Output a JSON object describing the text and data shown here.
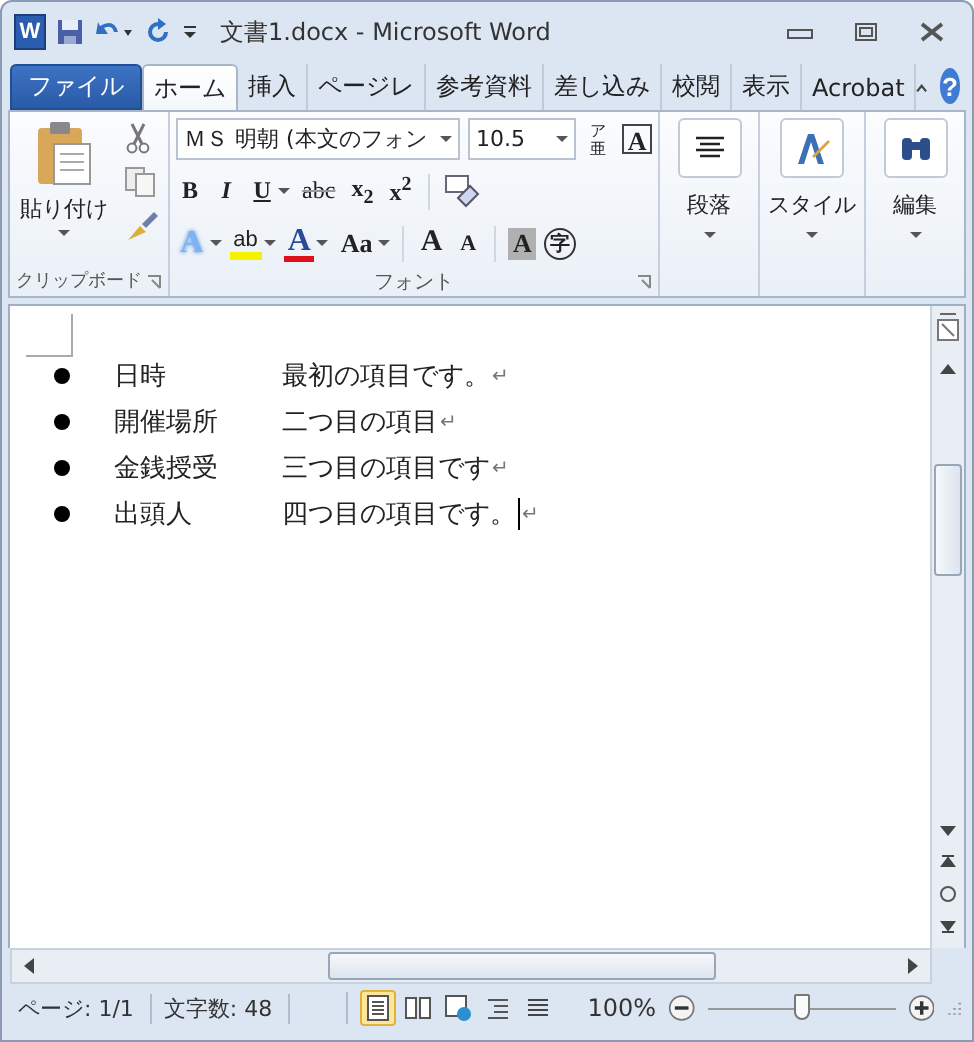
{
  "window": {
    "app_icon": "W",
    "title": "文書1.docx - Microsoft Word",
    "help": "?"
  },
  "tabs": [
    {
      "label": "ファイル",
      "kind": "file",
      "selected": false
    },
    {
      "label": "ホーム",
      "kind": "tab",
      "selected": true
    },
    {
      "label": "挿入",
      "kind": "tab",
      "selected": false
    },
    {
      "label": "ページレ",
      "kind": "tab",
      "selected": false
    },
    {
      "label": "参考資料",
      "kind": "tab",
      "selected": false
    },
    {
      "label": "差し込み",
      "kind": "tab",
      "selected": false
    },
    {
      "label": "校閲",
      "kind": "tab",
      "selected": false
    },
    {
      "label": "表示",
      "kind": "tab",
      "selected": false
    },
    {
      "label": "Acrobat",
      "kind": "tab",
      "selected": false
    }
  ],
  "ribbon": {
    "clipboard": {
      "paste": "貼り付け",
      "label": "クリップボード"
    },
    "font": {
      "font_name": "ＭＳ 明朝 (本文のフォン",
      "font_size": "10.5",
      "phonetic_top": "ア",
      "phonetic_bottom": "亜",
      "border_char": "A",
      "row2": [
        {
          "text": "B",
          "kind": "bold"
        },
        {
          "text": "I",
          "kind": "italic"
        },
        {
          "text": "U",
          "kind": "underline"
        },
        {
          "text": "abc",
          "kind": "strike"
        },
        {
          "text": "x$_{2}$",
          "kind": "plain"
        },
        {
          "text": "x$^{2}$",
          "kind": "plain"
        }
      ],
      "row3": [
        {
          "text": "A",
          "kind": "effects"
        },
        {
          "text": "ab",
          "kind": "highlight"
        },
        {
          "text": "A",
          "kind": "color"
        },
        {
          "text": "Aa",
          "kind": "case"
        },
        {
          "text": "A",
          "kind": "grow"
        },
        {
          "text": "A",
          "kind": "shrink"
        },
        {
          "text": "A",
          "kind": "shade"
        },
        {
          "text": "字",
          "kind": "circle"
        }
      ],
      "label": "フォント"
    },
    "paragraph": {
      "label": "段落"
    },
    "styles": {
      "label": "スタイル"
    },
    "editing": {
      "label": "編集"
    }
  },
  "document": {
    "items": [
      {
        "term": "日時",
        "text": "最初の項目です。",
        "mark": "↵",
        "cursor": false
      },
      {
        "term": "開催場所",
        "text": "二つ目の項目",
        "mark": "↵",
        "cursor": false
      },
      {
        "term": "金銭授受",
        "text": "三つ目の項目です",
        "mark": "↵",
        "cursor": false
      },
      {
        "term": "出頭人",
        "text": "四つ目の項目です。",
        "mark": "↵",
        "cursor": true
      }
    ]
  },
  "status_bar": {
    "page": "ページ: 1/1",
    "words": "文字数: 48",
    "views": [
      {
        "kind": "print",
        "selected": true
      },
      {
        "kind": "read",
        "selected": false
      },
      {
        "kind": "web",
        "selected": false
      },
      {
        "kind": "outline",
        "selected": false
      },
      {
        "kind": "draft",
        "selected": false
      }
    ],
    "zoom": "100%",
    "zoom_slider": {
      "level": 0.5
    }
  }
}
